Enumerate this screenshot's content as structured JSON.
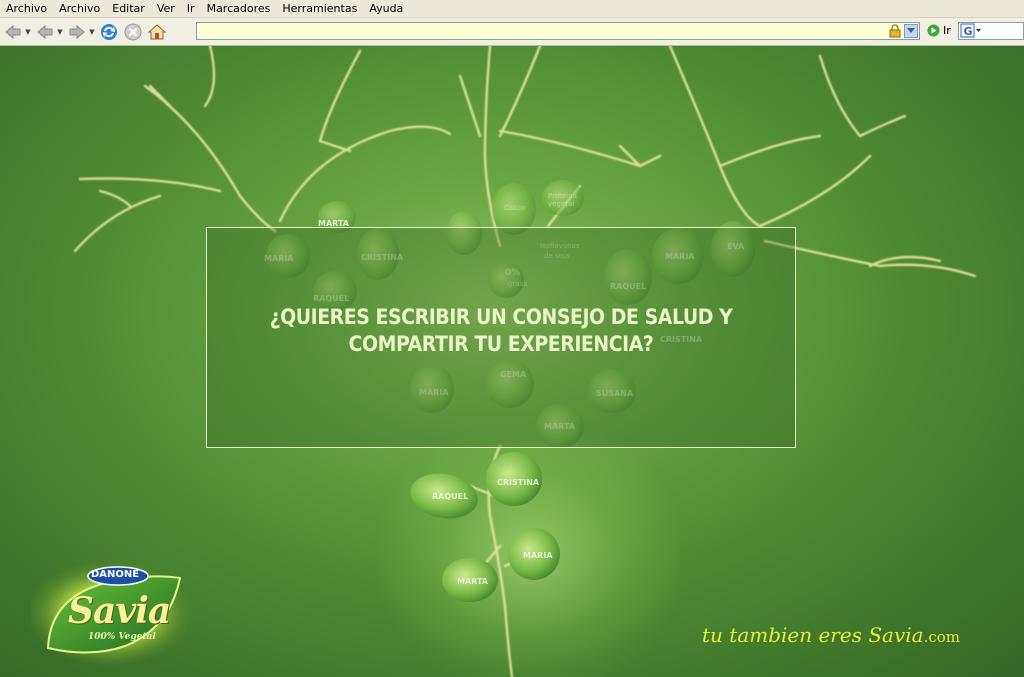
{
  "browser": {
    "menu": [
      "Archivo",
      "Archivo",
      "Editar",
      "Ver",
      "Ir",
      "Marcadores",
      "Herramientas",
      "Ayuda"
    ],
    "address": {
      "value": ""
    },
    "go_label": "Ir",
    "icons": [
      "back-icon",
      "back-icon",
      "forward-icon",
      "reload-icon",
      "stop-icon",
      "home-icon",
      "lock-icon",
      "go-icon",
      "search-icon"
    ]
  },
  "page": {
    "headline_line1": "¿QUIERES ESCRIBIR UN CONSEJO DE SALUD Y",
    "headline_line2": "COMPARTIR TU EXPERIENCIA?",
    "tagline_main": "tu tambien eres Savia",
    "tagline_suffix": ".com",
    "logo": {
      "brand": "DANONE",
      "product": "Savia",
      "claim": "100% Vegetal"
    },
    "leaf_names": {
      "marta_top": "MARTA",
      "maria_left": "MARIA",
      "cristina_left": "CRISTINA",
      "raquel_left": "RAQUEL",
      "calcio": "Calcio",
      "proteina": "Proteina vegetal",
      "isoflavonas_1": "Isoflavonas",
      "isoflavonas_2": "de soja",
      "zero": "0%",
      "grasa": "grasa",
      "maria_right": "MARIA",
      "eva": "EVA",
      "raquel_right": "RAQUEL",
      "cristina_right": "CRISTINA",
      "gema": "GEMA",
      "maria_mid": "MARIA",
      "susana": "SUSANA",
      "marta_mid": "MARTA",
      "raquel_low": "RAQUEL",
      "cristina_low": "CRISTINA",
      "maria_low": "MARIA",
      "marta_low": "MARTA"
    },
    "colors": {
      "background": "#4f8a33",
      "headline": "#e9f6c6",
      "tagline": "#e3ef3a"
    }
  }
}
